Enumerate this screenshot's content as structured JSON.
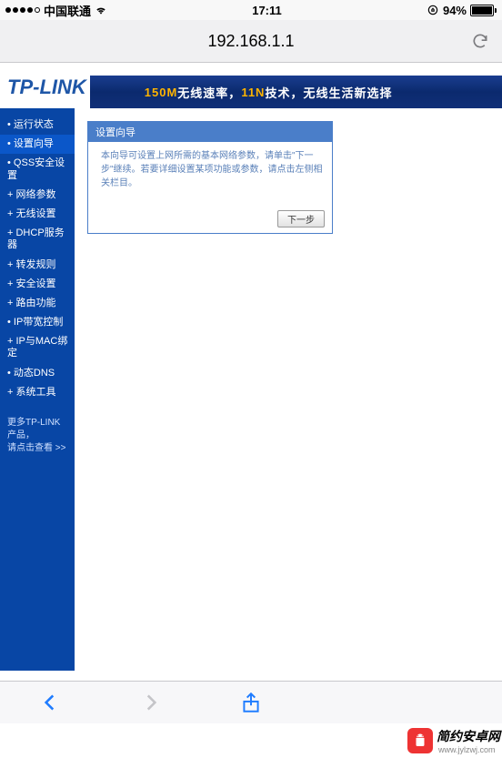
{
  "status": {
    "carrier": "中国联通",
    "time": "17:11",
    "battery_pct": "94%"
  },
  "browser": {
    "url": "192.168.1.1"
  },
  "header": {
    "logo": "TP-LINK",
    "banner_1": "150M",
    "banner_2": "无线速率，",
    "banner_3": "11N",
    "banner_4": "技术，无线生活新选择"
  },
  "sidebar": {
    "items": [
      {
        "label": "运行状态",
        "plus": false
      },
      {
        "label": "设置向导",
        "plus": false,
        "active": true
      },
      {
        "label": "QSS安全设置",
        "plus": false
      },
      {
        "label": "网络参数",
        "plus": true
      },
      {
        "label": "无线设置",
        "plus": true
      },
      {
        "label": "DHCP服务器",
        "plus": true
      },
      {
        "label": "转发规则",
        "plus": true
      },
      {
        "label": "安全设置",
        "plus": true
      },
      {
        "label": "路由功能",
        "plus": true
      },
      {
        "label": "IP带宽控制",
        "plus": false
      },
      {
        "label": "IP与MAC绑定",
        "plus": true
      },
      {
        "label": "动态DNS",
        "plus": false
      },
      {
        "label": "系统工具",
        "plus": true
      }
    ],
    "promo_line1": "更多TP-LINK产品，",
    "promo_line2": "请点击查看 >>"
  },
  "panel": {
    "title": "设置向导",
    "body": "本向导可设置上网所需的基本网络参数，请单击\"下一步\"继续。若要详细设置某项功能或参数，请点击左侧相关栏目。",
    "next": "下一步"
  },
  "watermark": {
    "name": "简约安卓网",
    "url": "www.jylzwj.com"
  }
}
